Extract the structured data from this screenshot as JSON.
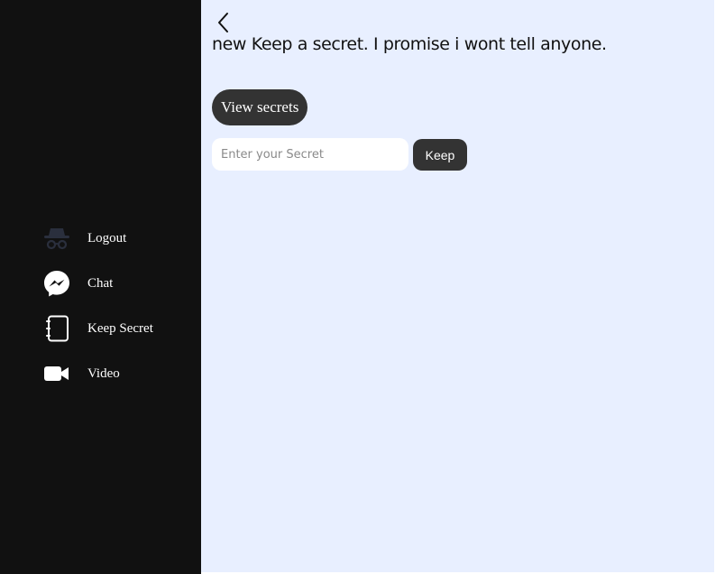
{
  "sidebar": {
    "items": [
      {
        "label": "Logout",
        "icon": "incognito-icon"
      },
      {
        "label": "Chat",
        "icon": "messenger-icon"
      },
      {
        "label": "Keep Secret",
        "icon": "notebook-icon"
      },
      {
        "label": "Video",
        "icon": "video-camera-icon"
      }
    ]
  },
  "main": {
    "back_icon": "chevron-left-icon",
    "heading": "new Keep a secret. I promise i wont tell anyone.",
    "view_secrets_label": "View secrets",
    "secret_input": {
      "placeholder": "Enter your Secret",
      "value": ""
    },
    "keep_label": "Keep"
  },
  "colors": {
    "sidebar_bg": "#111111",
    "main_bg": "#e8efff",
    "button_bg": "#333333",
    "text_light": "#ffffff"
  }
}
